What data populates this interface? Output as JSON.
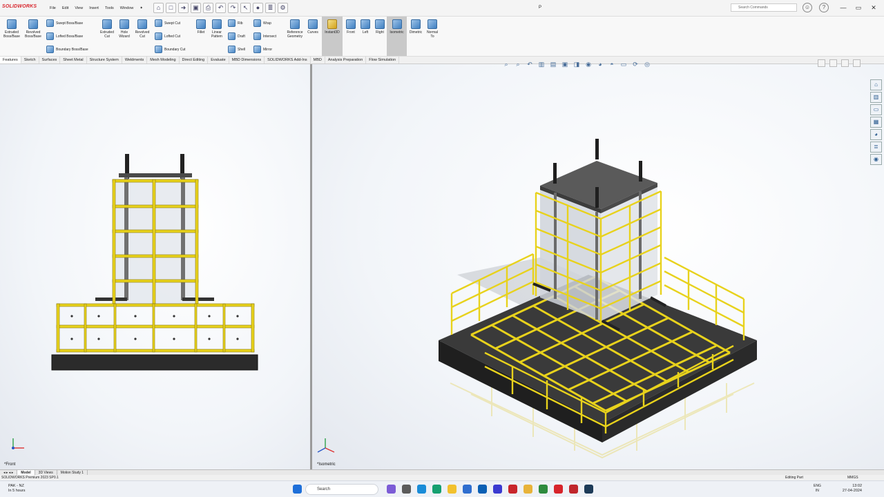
{
  "app": {
    "brand": "SOLIDWORKS",
    "doc_title": "P"
  },
  "menu": [
    "File",
    "Edit",
    "View",
    "Insert",
    "Tools",
    "Window"
  ],
  "search": {
    "placeholder": "Search Commands"
  },
  "ribbon": {
    "extruded_boss": "Extruded Boss/Base",
    "revolved_boss": "Revolved Boss/Base",
    "swept_boss": "Swept Boss/Base",
    "lofted_boss": "Lofted Boss/Base",
    "boundary_boss": "Boundary Boss/Base",
    "extruded_cut": "Extruded Cut",
    "hole_wizard": "Hole Wizard",
    "revolved_cut": "Revolved Cut",
    "swept_cut": "Swept Cut",
    "lofted_cut": "Lofted Cut",
    "boundary_cut": "Boundary Cut",
    "fillet": "Fillet",
    "linear_pattern": "Linear Pattern",
    "rib": "Rib",
    "draft": "Draft",
    "shell": "Shell",
    "wrap": "Wrap",
    "intersect": "Intersect",
    "mirror": "Mirror",
    "reference_geometry": "Reference Geometry",
    "curves": "Curves",
    "instant3d": "Instant3D",
    "front": "Front",
    "left": "Left",
    "right": "Right",
    "isometric": "Isometric",
    "dimetric": "Dimetric",
    "normal_to": "Normal To"
  },
  "tabs": [
    "Features",
    "Sketch",
    "Surfaces",
    "Sheet Metal",
    "Structure System",
    "Weldments",
    "Mesh Modeling",
    "Direct Editing",
    "Evaluate",
    "MBD Dimensions",
    "SOLIDWORKS Add-Ins",
    "MBD",
    "Analysis Preparation",
    "Flow Simulation"
  ],
  "viewports": {
    "left_label": "*Front",
    "right_label": "*Isometric"
  },
  "bottom_tabs": [
    "Model",
    "3D Views",
    "Motion Study 1"
  ],
  "status": {
    "version": "SOLIDWORKS Premium 2023 SP0.1",
    "mode": "Editing Part",
    "units": "MMGS"
  },
  "taskbar": {
    "weather_line1": "PAK - NZ",
    "weather_line2": "In 5 hours",
    "search": "Search",
    "lang_line1": "ENG",
    "lang_line2": "IN",
    "time": "13:02",
    "date": "27-04-2024"
  },
  "colors": {
    "rebar": "#e8d21c",
    "concrete": "#2b2b2b",
    "plate": "#5a5a5a",
    "accent": "#d7242b"
  }
}
